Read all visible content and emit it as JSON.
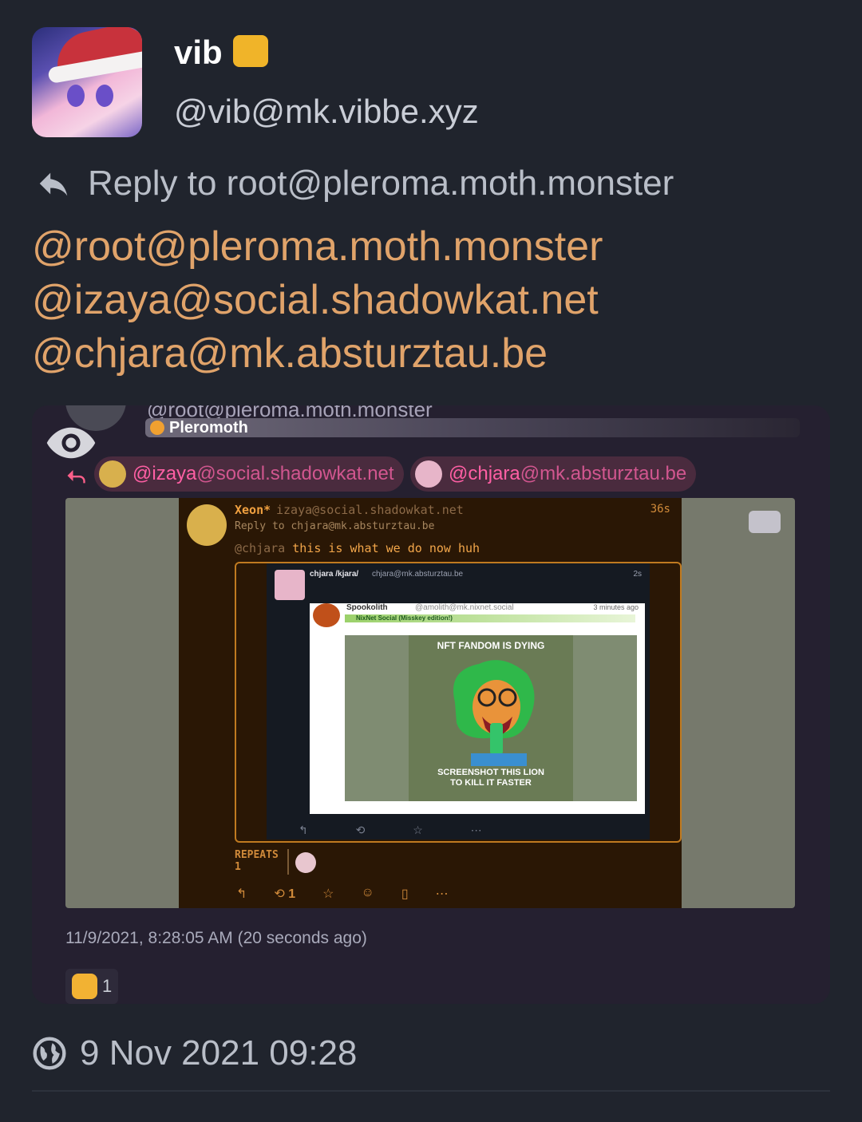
{
  "author": {
    "display_name": "vib",
    "handle": "@vib@mk.vibbe.xyz"
  },
  "reply_to": {
    "label": "Reply to root@pleroma.moth.monster"
  },
  "mentions": [
    "@root@pleroma.moth.monster",
    "@izaya@social.shadowkat.net",
    "@chjara@mk.absturztau.be"
  ],
  "screenshot": {
    "top_handle": "@root@pleroma.moth.monster",
    "instance_name": "Pleromoth",
    "mention_pills": [
      {
        "user": "@izaya",
        "host": "@social.shadowkat.net"
      },
      {
        "user": "@chjara",
        "host": "@mk.absturztau.be"
      }
    ],
    "embedded_post": {
      "name": "Xeon*",
      "handle": "izaya@social.shadowkat.net",
      "time": "36s",
      "reply_to": "Reply to chjara@mk.absturztau.be",
      "mention": "@chjara",
      "text": " this is what we do now huh",
      "quote": {
        "name": "chjara /kjara/",
        "handle": "chjara@mk.absturztau.be",
        "time": "2s",
        "inner_post": {
          "name": "Spookolith",
          "handle": "@amolith@mk.nixnet.social",
          "instance": "NixNet Social (Misskey edition!)",
          "time": "3 minutes ago",
          "meme_top": "NFT FANDOM IS DYING",
          "meme_bottom_line1": "SCREENSHOT THIS LION",
          "meme_bottom_line2": "TO KILL IT FASTER"
        }
      },
      "repeats_label": "REPEATS",
      "repeats_count": "1",
      "retoot_count": "1"
    },
    "date": "11/9/2021, 8:28:05 AM (20 seconds ago)",
    "reaction_count": "1"
  },
  "footer": {
    "date": "9 Nov 2021 09:28"
  },
  "colors": {
    "background": "#20242d",
    "mention": "#e0a36a",
    "pink": "#ff5fa4",
    "orange": "#f0a040"
  }
}
